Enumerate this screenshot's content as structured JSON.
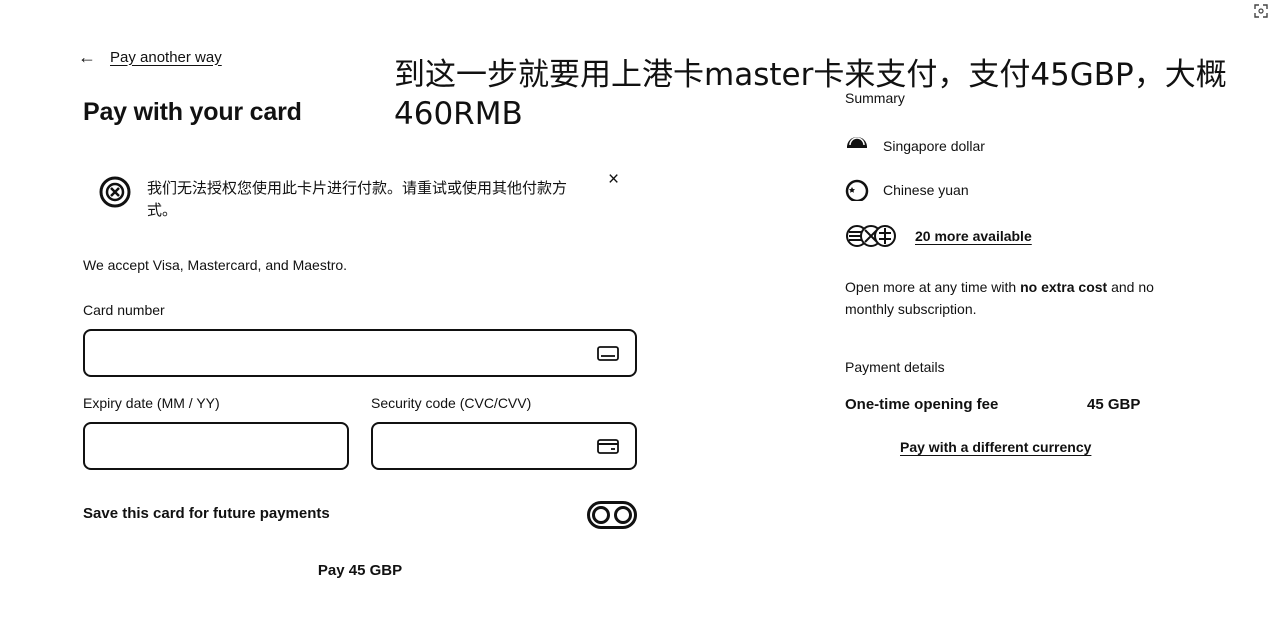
{
  "overlay_annotation": "到这一步就要用上港卡master卡来支付，支付45GBP，大概460RMB",
  "back_link": {
    "label": "Pay another way"
  },
  "page_title": "Pay with your card",
  "error_banner": {
    "message": "我们无法授权您使用此卡片进行付款。请重试或使用其他付款方式。",
    "close_glyph": "×"
  },
  "accepted_cards_text": "We accept Visa, Mastercard, and Maestro.",
  "form": {
    "card_number": {
      "label": "Card number",
      "value": "",
      "placeholder": ""
    },
    "expiry": {
      "label": "Expiry date (MM / YY)",
      "value": "",
      "placeholder": ""
    },
    "security_code": {
      "label": "Security code (CVC/CVV)",
      "value": "",
      "placeholder": ""
    },
    "save_card": {
      "label": "Save this card for future payments"
    },
    "pay_button": "Pay 45 GBP"
  },
  "summary": {
    "title": "Summary",
    "currencies": [
      {
        "name": "Singapore dollar",
        "icon": "singapore-flag-icon"
      },
      {
        "name": "Chinese yuan",
        "icon": "china-flag-icon"
      }
    ],
    "more_available": "20 more available",
    "open_more_prefix": "Open more at any time with ",
    "open_more_bold": "no extra cost",
    "open_more_suffix": " and no monthly subscription.",
    "payment_details_label": "Payment details",
    "fee_label": "One-time opening fee",
    "fee_value": "45 GBP",
    "different_currency_link": "Pay with a different currency"
  }
}
